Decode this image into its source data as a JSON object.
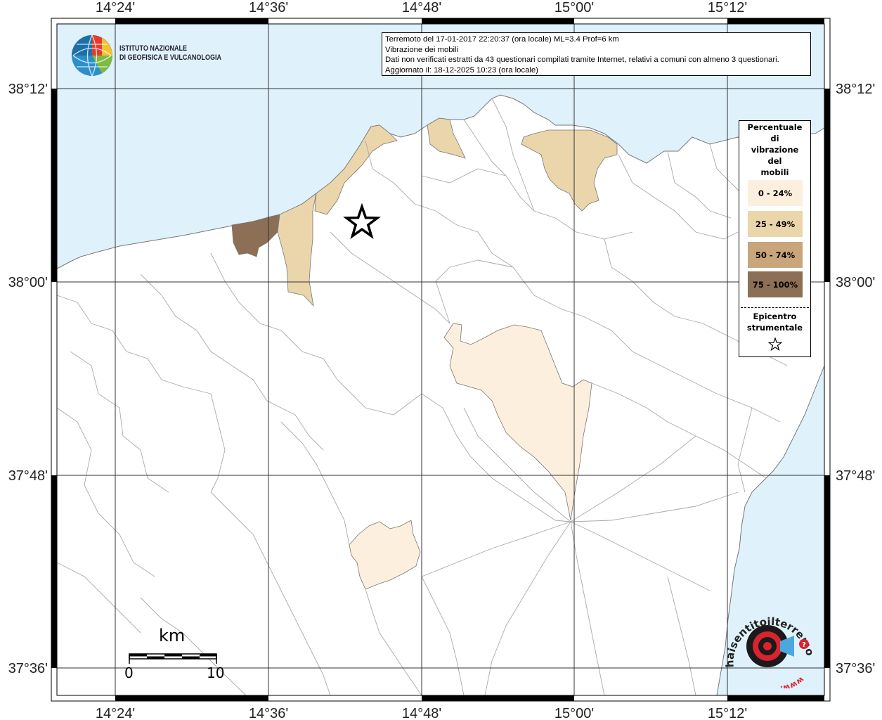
{
  "info": {
    "line1": "Terremoto del 17-01-2017 22:20:37 (ora locale) ML=3.4 Prof=6 km",
    "line2": "Vibrazione dei mobili",
    "line3": "Dati non verificati estratti da 43 questionari compilati tramite Internet, relativi a comuni con almeno 3 questionari.",
    "line4": "Aggiornato il: 18-12-2025 10:23 (ora locale)"
  },
  "ingv": {
    "line1": "ISTITUTO NAZIONALE",
    "line2": "DI GEOFISICA E VULCANOLOGIA"
  },
  "axes": {
    "top": [
      "14°24'",
      "14°36'",
      "14°48'",
      "15°00'",
      "15°12'"
    ],
    "bottom": [
      "14°24'",
      "14°36'",
      "14°48'",
      "15°00'",
      "15°12'"
    ],
    "left": [
      "38°12'",
      "38°00'",
      "37°48'",
      "37°36'"
    ],
    "right": [
      "38°12'",
      "38°00'",
      "37°48'",
      "37°36'"
    ]
  },
  "legend": {
    "title": [
      "Percentuale",
      "di",
      "vibrazione",
      "del",
      "mobili"
    ],
    "items": [
      {
        "label": "0 - 24%",
        "color": "#fdefdd"
      },
      {
        "label": "25 - 49%",
        "color": "#ebd5ab"
      },
      {
        "label": "50 - 74%",
        "color": "#c8a57a"
      },
      {
        "label": "75 - 100%",
        "color": "#8c6f55"
      }
    ],
    "epicentre": [
      "Epicentro",
      "strumentale"
    ]
  },
  "scale": {
    "unit": "km",
    "min": "0",
    "max": "10"
  },
  "logo": {
    "text": "haisentitoilterremoto.it",
    "www": "www."
  },
  "colors": {
    "sea": "#dff1fb",
    "land": "#ffffff",
    "grid": "#333333",
    "border": "#aaaaaa"
  }
}
